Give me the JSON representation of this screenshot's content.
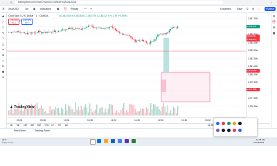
{
  "browser": {
    "url": "tradingview.com/chart/?symbol=OANDA%3AXAUUSD",
    "back_icon": "arrow-left-icon",
    "forward_icon": "arrow-right-icon",
    "reload_icon": "reload-icon"
  },
  "toolbar": {
    "symbol": "XAUUSD",
    "interval": "1m",
    "indicators_label": "Indicators",
    "replay_label": "Replay",
    "unnamed_label": "Unnamed",
    "save_label": "Save",
    "publish_label": "Publish"
  },
  "legend": {
    "title": "Gold Spot / U.S. Dollar · 1 · OANDA",
    "ohlc": "O2,383.005 H2,383.480 L2,382.575 C2,383.275 +1.275 (+0.05%)",
    "sell_price": "2,382.650",
    "sell_label": "SELL",
    "spread": "0.3",
    "buy_price": "2,382.950",
    "buy_label": "BUY"
  },
  "price_scale": {
    "labels": [
      "2,387.000",
      "2,386.000",
      "2,385.000",
      "2,384.000",
      "2,383.000",
      "2,382.000",
      "2,381.000",
      "2,380.000",
      "2,379.000",
      "2,378.000",
      "2,377.000",
      "2,376.000"
    ],
    "tag_green": "2,386.840",
    "tag_current": "2,383.275",
    "tag_current_name": "XAUUSD",
    "tag_red": "2,379.600",
    "tag_red2": "2,377.880"
  },
  "time_axis": [
    "09:00",
    "09:30",
    "10:00",
    "10:30",
    "11:00",
    "11:30",
    "12:00",
    "12:30",
    "13:00",
    "13:30"
  ],
  "range_bar": {
    "items": [
      "1D",
      "5D",
      "1M",
      "3M",
      "6M",
      "YTD",
      "1Y",
      "5Y",
      "All"
    ],
    "time": "11:35:24 (UTC+2)",
    "pct": "%",
    "log": "log",
    "auto": "auto"
  },
  "panel_tabs": [
    "Pine Editor",
    "Trading Panel"
  ],
  "logo_text": "TradingView",
  "taskbar": {
    "weather": "Partly sunny",
    "temp": "21°C",
    "clock": "11:35 AM",
    "date": "12/18/2024"
  },
  "chart_data": {
    "type": "candlestick",
    "symbol": "XAUUSD",
    "timeframe": "1m",
    "ylim": [
      2376,
      2387.5
    ]
  }
}
